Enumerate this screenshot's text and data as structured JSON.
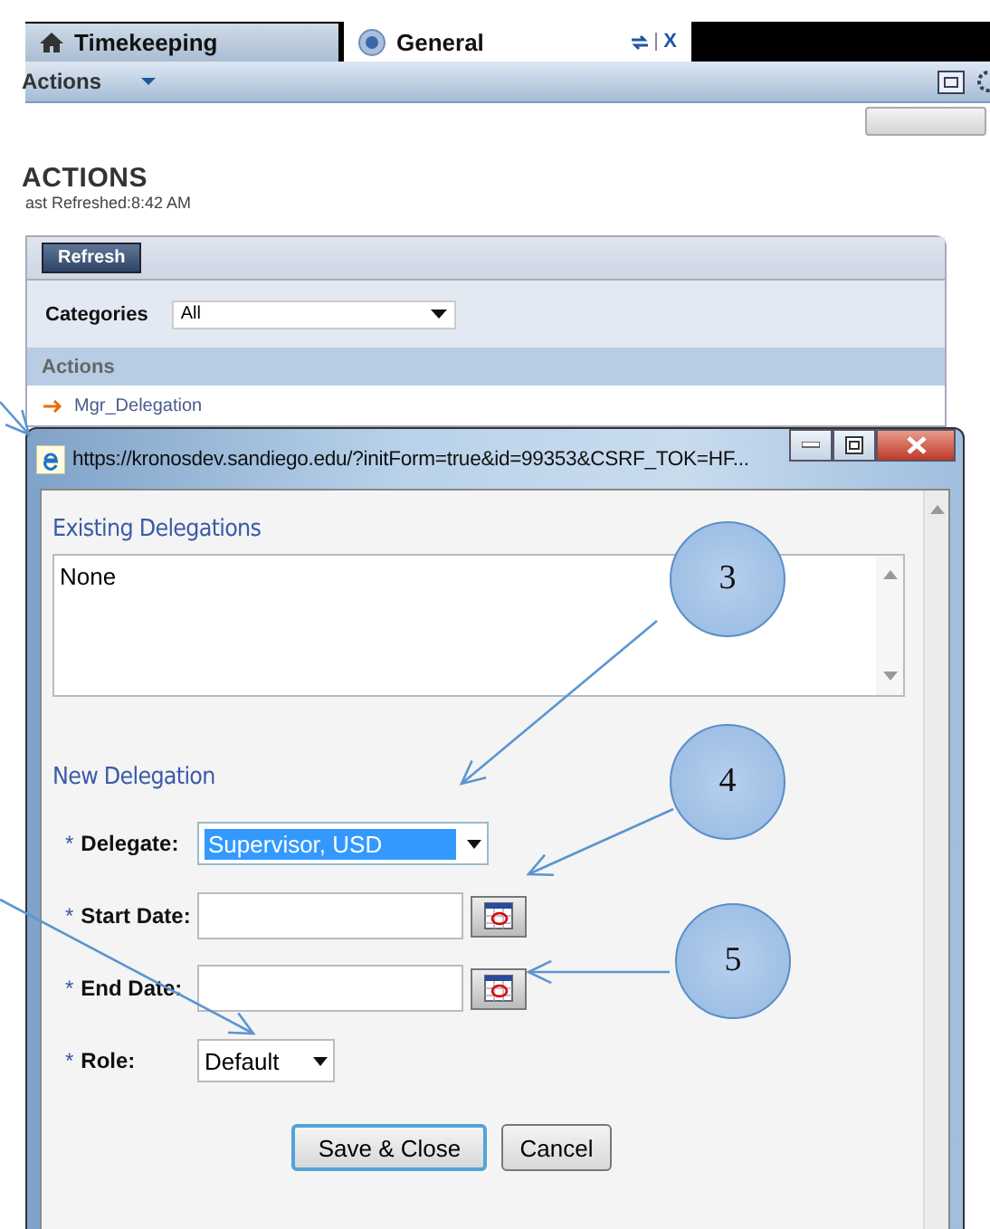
{
  "tabs": [
    {
      "label": "Timekeeping",
      "selected": false
    },
    {
      "label": "General",
      "selected": true
    }
  ],
  "tab_close": "X",
  "toolbar": {
    "menu": "Actions"
  },
  "page": {
    "title": "ACTIONS",
    "refreshed": "ast Refreshed:8:42 AM"
  },
  "panel": {
    "refresh_button": "Refresh",
    "categories_label": "Categories",
    "categories_value": "All",
    "actions_header": "Actions",
    "actions": [
      {
        "label": "Mgr_Delegation"
      }
    ]
  },
  "popup": {
    "url": "https://kronosdev.sandiego.edu/?initForm=true&id=99353&CSRF_TOK=HF...",
    "existing_title": "Existing Delegations",
    "existing": [
      "None"
    ],
    "new_title": "New Delegation",
    "fields": [
      {
        "kind": "select",
        "mark": "*",
        "label": "Delegate:",
        "value": "Supervisor, USD",
        "highlighted": true
      },
      {
        "kind": "date",
        "mark": "*",
        "label": "Start Date:"
      },
      {
        "kind": "date",
        "mark": "*",
        "label": "End Date:"
      },
      {
        "kind": "select",
        "mark": "*",
        "label": "Role:",
        "value": "Default",
        "highlighted": false
      }
    ],
    "buttons": [
      {
        "label": "Save & Close",
        "focused": true
      },
      {
        "label": "Cancel",
        "focused": false
      }
    ]
  },
  "callouts": [
    {
      "label": "3"
    },
    {
      "label": "4"
    },
    {
      "label": "5"
    }
  ]
}
